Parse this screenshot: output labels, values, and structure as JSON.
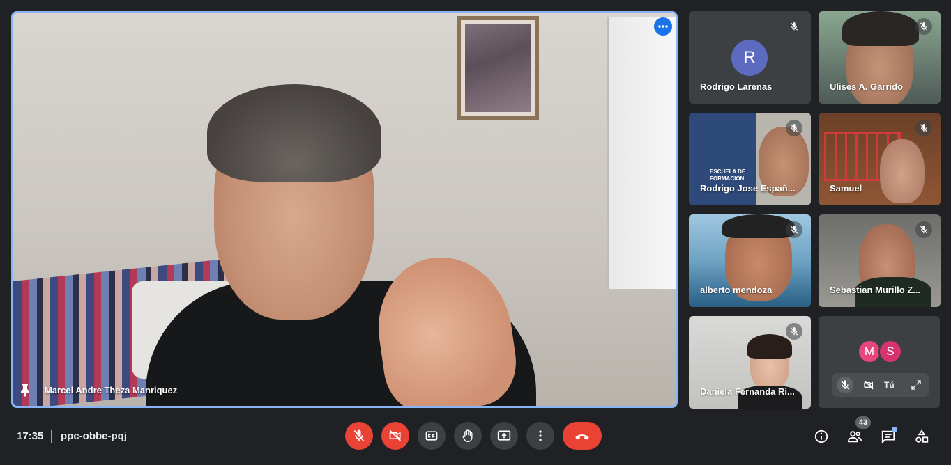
{
  "main_speaker": {
    "name": "Marcel Andre Theza Manriquez"
  },
  "tiles": [
    {
      "name": "Rodrigo Larenas",
      "initial": "R",
      "muted": true
    },
    {
      "name": "Ulises A. Garrido",
      "muted": true
    },
    {
      "name": "Rodrigo Jose Españ...",
      "muted": true,
      "background_text": "ESCUELA DE FORMACIÓN"
    },
    {
      "name": "Samuel",
      "muted": true
    },
    {
      "name": "alberto mendoza",
      "muted": true
    },
    {
      "name": "Sebastian Murillo Z...",
      "muted": true
    },
    {
      "name": "Daniela Fernanda Ri...",
      "muted": true
    }
  ],
  "self_tile": {
    "avatars": [
      "M",
      "S"
    ],
    "avatar_colors": [
      "#e8457a",
      "#d6336c"
    ],
    "label": "Tú"
  },
  "bottom_bar": {
    "time": "17:35",
    "meeting_code": "ppc-obbe-pqj",
    "participants_count": "43"
  },
  "colors": {
    "accent": "#8ab4f8",
    "danger": "#ea4335",
    "surface": "#3c4043",
    "background": "#202124"
  }
}
